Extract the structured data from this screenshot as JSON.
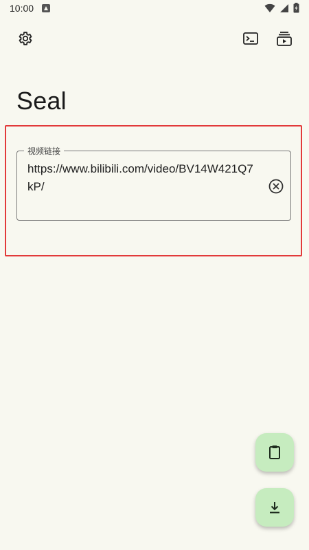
{
  "status_bar": {
    "time": "10:00",
    "icons": [
      "app-notification-icon",
      "wifi-icon",
      "signal-icon",
      "battery-icon"
    ]
  },
  "toolbar": {
    "icons": [
      "settings-icon",
      "terminal-icon",
      "playlist-icon"
    ]
  },
  "app": {
    "title": "Seal"
  },
  "url_field": {
    "label": "视频链接",
    "value": "https://www.bilibili.com/video/BV14W421Q7kP/",
    "clear_icon": "clear-circle-icon"
  },
  "fabs": {
    "paste_icon": "clipboard-icon",
    "download_icon": "download-icon"
  },
  "colors": {
    "background": "#f8f8f0",
    "fab": "#c6ecbf",
    "highlight": "#e23a3a"
  }
}
